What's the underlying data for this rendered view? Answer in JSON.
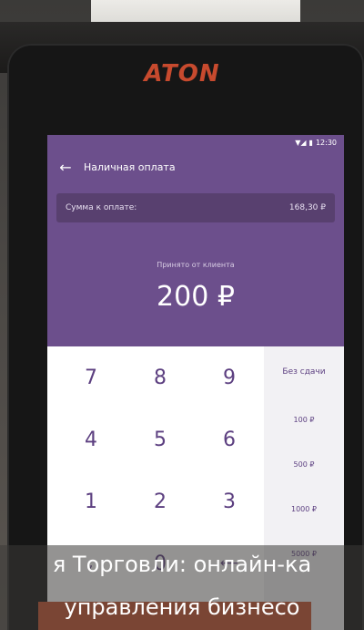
{
  "device": {
    "brand": "ATON"
  },
  "status": {
    "time": "12:30",
    "signal": "▼◢",
    "battery": "▮"
  },
  "header": {
    "title": "Наличная оплата"
  },
  "payment": {
    "amount_label": "Сумма к оплате:",
    "amount_value": "168,30 ₽"
  },
  "received": {
    "label": "Принято от клиента",
    "value": "200 ₽"
  },
  "keypad": {
    "keys": [
      "7",
      "8",
      "9",
      "4",
      "5",
      "6",
      "1",
      "2",
      "3",
      ",",
      "0",
      "⟵"
    ]
  },
  "quick": {
    "items": [
      "Без сдачи",
      "100 ₽",
      "500 ₽",
      "1000 ₽",
      "5000 ₽"
    ]
  },
  "caption": {
    "line1": "я Торговли: онлайн-ка",
    "line2": "управления бизнесо"
  },
  "colors": {
    "accent": "#6c4f8c",
    "brand": "#c74a2e",
    "key": "#5c3f80"
  }
}
